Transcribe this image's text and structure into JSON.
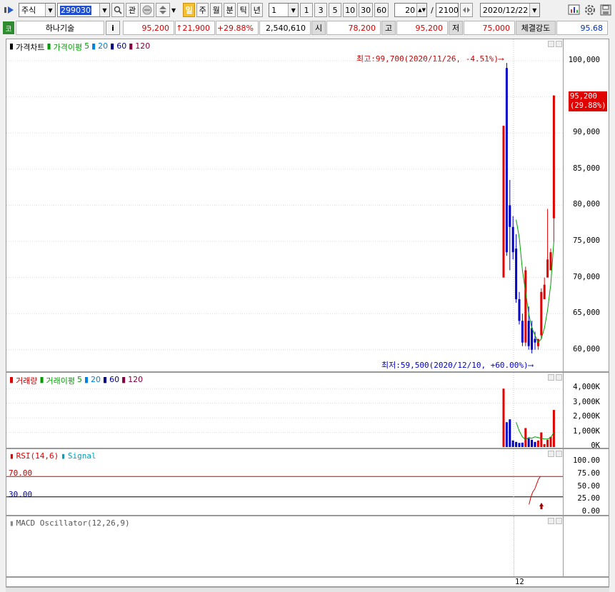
{
  "toolbar": {
    "market": "주식",
    "code": "299030",
    "btn_gwan": "관",
    "periods": [
      "일",
      "주",
      "월",
      "분",
      "틱",
      "년"
    ],
    "interval": "1",
    "quick_intervals": [
      "1",
      "3",
      "5",
      "10",
      "30",
      "60"
    ],
    "count": "20",
    "count_total": "2100",
    "count_sep": "/",
    "date": "2020/12/22"
  },
  "quote": {
    "code_badge": "코",
    "stock_name": "하나기술",
    "info_btn": "i",
    "price": "95,200",
    "change": "↑21,900",
    "change_pct": "+29.88%",
    "volume": "2,540,610",
    "open_label": "시",
    "open": "78,200",
    "high_label": "고",
    "high": "95,200",
    "low_label": "저",
    "low": "75,000",
    "strength_label": "체결강도",
    "strength": "95.68"
  },
  "price_panel": {
    "legend": {
      "title": "가격차트",
      "ma_title": "가격이평",
      "ma": [
        "5",
        "20",
        "60",
        "120"
      ]
    },
    "max_annot": "최고:99,700(2020/11/26, -4.51%)⟶",
    "min_annot": "최저:59,500(2020/12/10, +60.00%)⟶",
    "current_price": "95,200",
    "current_pct": "(29.88%)",
    "yticks": [
      "100,000",
      "95,000",
      "90,000",
      "85,000",
      "80,000",
      "75,000",
      "70,000",
      "65,000",
      "60,000"
    ]
  },
  "volume_panel": {
    "legend": {
      "title": "거래량",
      "ma_title": "거래이평",
      "ma": [
        "5",
        "20",
        "60",
        "120"
      ]
    },
    "yticks": [
      "4,000K",
      "3,000K",
      "2,000K",
      "1,000K",
      "0K"
    ]
  },
  "rsi_panel": {
    "legend": {
      "rsi": "RSI(14,6)",
      "signal": "Signal"
    },
    "level_high": "70.00",
    "level_low": "30.00",
    "yticks": [
      "100.00",
      "75.00",
      "50.00",
      "25.00",
      "0.00"
    ]
  },
  "macd_panel": {
    "legend": "MACD Oscillator(12,26,9)"
  },
  "xaxis": {
    "label": "12"
  },
  "colors": {
    "up": "#e00000",
    "down": "#0000c8",
    "ma": "#00a000",
    "accent": "#f5c030"
  },
  "chart_data": [
    {
      "type": "candlestick",
      "title": "가격차트",
      "candles": [
        {
          "o": 70000,
          "h": 91000,
          "l": 70000,
          "c": 91000
        },
        {
          "o": 99000,
          "h": 99700,
          "l": 73000,
          "c": 73500
        },
        {
          "o": 80000,
          "h": 83500,
          "l": 71000,
          "c": 77000
        },
        {
          "o": 77000,
          "h": 78500,
          "l": 72500,
          "c": 73500
        },
        {
          "o": 74000,
          "h": 76000,
          "l": 66500,
          "c": 67000
        },
        {
          "o": 67000,
          "h": 68000,
          "l": 63500,
          "c": 64000
        },
        {
          "o": 64000,
          "h": 65000,
          "l": 60500,
          "c": 61000
        },
        {
          "o": 61000,
          "h": 71500,
          "l": 60500,
          "c": 71000
        },
        {
          "o": 64000,
          "h": 66000,
          "l": 60000,
          "c": 60500
        },
        {
          "o": 63000,
          "h": 64000,
          "l": 59500,
          "c": 60000
        },
        {
          "o": 61500,
          "h": 62500,
          "l": 60000,
          "c": 61000
        },
        {
          "o": 60500,
          "h": 61500,
          "l": 60000,
          "c": 61500
        },
        {
          "o": 62000,
          "h": 68500,
          "l": 61500,
          "c": 68000
        },
        {
          "o": 67000,
          "h": 70000,
          "l": 67000,
          "c": 69000
        },
        {
          "o": 70000,
          "h": 79500,
          "l": 70000,
          "c": 72500
        },
        {
          "o": 71000,
          "h": 74000,
          "l": 71000,
          "c": 73500
        },
        {
          "o": 78200,
          "h": 95200,
          "l": 75000,
          "c": 95200
        }
      ],
      "ma5": [
        null,
        null,
        null,
        null,
        78000,
        75500,
        71000,
        68000,
        65000,
        63000,
        62000,
        61000,
        61500,
        63000,
        65500,
        69000,
        75000
      ],
      "ylim": [
        58000,
        101000
      ]
    },
    {
      "type": "bar",
      "title": "거래량",
      "values": [
        4000,
        1700,
        1900,
        450,
        350,
        280,
        300,
        1300,
        600,
        500,
        350,
        450,
        1000,
        200,
        500,
        700,
        2540
      ],
      "ma5": [
        null,
        null,
        null,
        null,
        1700,
        1100,
        700,
        500,
        650,
        600,
        700,
        650,
        600,
        550,
        550,
        650,
        1000
      ],
      "ylim": [
        0,
        4500
      ]
    },
    {
      "type": "line",
      "title": "RSI(14,6)",
      "values": [
        null,
        null,
        null,
        null,
        null,
        null,
        null,
        null,
        null,
        null,
        null,
        null,
        15,
        30,
        40,
        45,
        55,
        65,
        70
      ],
      "ylim": [
        0,
        100
      ],
      "levels": [
        70,
        30
      ]
    }
  ]
}
